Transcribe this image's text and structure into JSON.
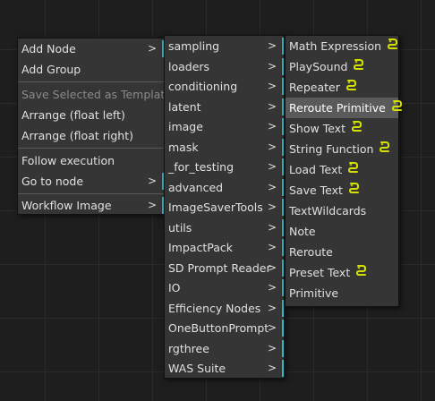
{
  "main_menu": {
    "items": [
      {
        "label": "Add Node",
        "submenu": true
      },
      {
        "label": "Add Group",
        "submenu": false
      },
      {
        "label": "Save Selected as Template",
        "disabled": true
      },
      {
        "label": "Arrange (float left)"
      },
      {
        "label": "Arrange (float right)"
      },
      {
        "label": "Follow execution"
      },
      {
        "label": "Go to node",
        "submenu": true
      },
      {
        "label": "Workflow Image",
        "submenu": true
      }
    ],
    "arrow": ">"
  },
  "categories_menu": {
    "items": [
      {
        "label": "sampling"
      },
      {
        "label": "loaders"
      },
      {
        "label": "conditioning"
      },
      {
        "label": "latent"
      },
      {
        "label": "image"
      },
      {
        "label": "mask"
      },
      {
        "label": "_for_testing"
      },
      {
        "label": "advanced"
      },
      {
        "label": "ImageSaverTools"
      },
      {
        "label": "utils"
      },
      {
        "label": "ImpactPack"
      },
      {
        "label": "SD Prompt Reader"
      },
      {
        "label": "IO"
      },
      {
        "label": "Efficiency Nodes"
      },
      {
        "label": "OneButtonPrompt"
      },
      {
        "label": "rgthree"
      },
      {
        "label": "WAS Suite"
      }
    ],
    "arrow": ">"
  },
  "utils_menu": {
    "items": [
      {
        "label": "Math Expression",
        "icon": "python-snake-icon"
      },
      {
        "label": "PlaySound",
        "icon": "python-snake-icon"
      },
      {
        "label": "Repeater",
        "icon": "python-snake-icon"
      },
      {
        "label": "Reroute Primitive",
        "icon": "python-snake-icon",
        "selected": true
      },
      {
        "label": "Show Text",
        "icon": "python-snake-icon"
      },
      {
        "label": "String Function",
        "icon": "python-snake-icon"
      },
      {
        "label": "Load Text",
        "icon": "python-snake-icon"
      },
      {
        "label": "Save Text",
        "icon": "python-snake-icon"
      },
      {
        "label": "TextWildcards"
      },
      {
        "label": "Note"
      },
      {
        "label": "Reroute"
      },
      {
        "label": "Preset Text",
        "icon": "python-snake-icon"
      },
      {
        "label": "Primitive"
      }
    ]
  },
  "colors": {
    "submenu_indicator": "#2fb7c9",
    "snake_icon": "#d4e000",
    "menu_bg": "#353535",
    "selected_bg": "#5a5a5a"
  }
}
